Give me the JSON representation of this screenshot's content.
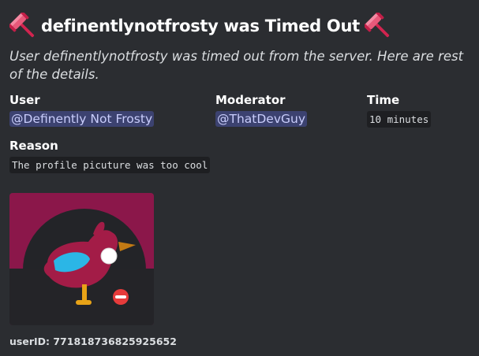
{
  "embed": {
    "title": "definentlynotfrosty was Timed Out",
    "description": "User definentlynotfrosty was timed out from the server. Here are rest of the details.",
    "fields": {
      "user": {
        "name": "User",
        "value": "@Definently Not Frosty"
      },
      "moderator": {
        "name": "Moderator",
        "value": "@ThatDevGuy"
      },
      "time": {
        "name": "Time",
        "value": "10 minutes"
      },
      "reason": {
        "name": "Reason",
        "value": "The profile picuture was too cool"
      }
    },
    "footer": "userID: 771818736825925652",
    "icons": {
      "title_left": "gavel-icon",
      "title_right": "gavel-icon",
      "avatar": "bird-avatar"
    },
    "colors": {
      "background": "#2b2d31",
      "mention_bg": "#3c4270",
      "mention_text": "#c9cdfb",
      "code_bg": "#1e1f22",
      "avatar_bg": "#8b174a"
    }
  }
}
